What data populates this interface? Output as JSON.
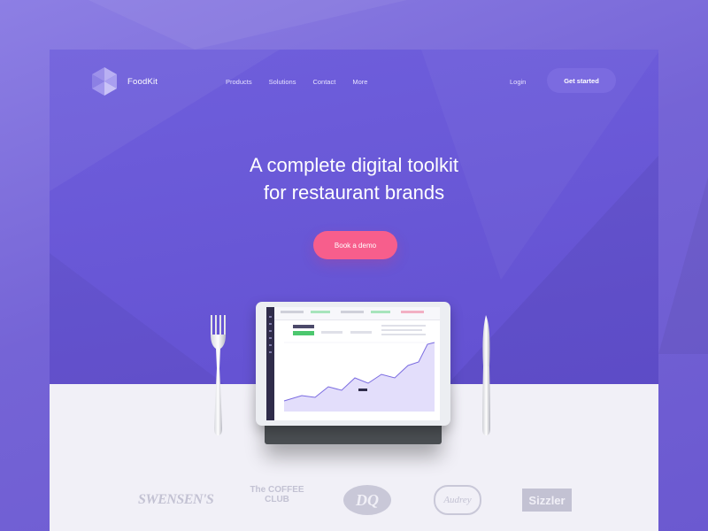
{
  "brand": {
    "name": "FoodKit"
  },
  "nav": {
    "items": [
      "Products",
      "Solutions",
      "Contact",
      "More"
    ],
    "login_label": "Login",
    "cta_label": "Get started"
  },
  "hero": {
    "headline_line1": "A complete digital toolkit",
    "headline_line2": "for restaurant brands",
    "cta_label": "Book a demo"
  },
  "clients": [
    "SWENSEN'S",
    "The COFFEE CLUB",
    "DQ",
    "Audrey",
    "Sizzler"
  ],
  "colors": {
    "primary": "#6553d3",
    "accent_button": "#f75e8c",
    "floor": "#f1f0f7"
  }
}
